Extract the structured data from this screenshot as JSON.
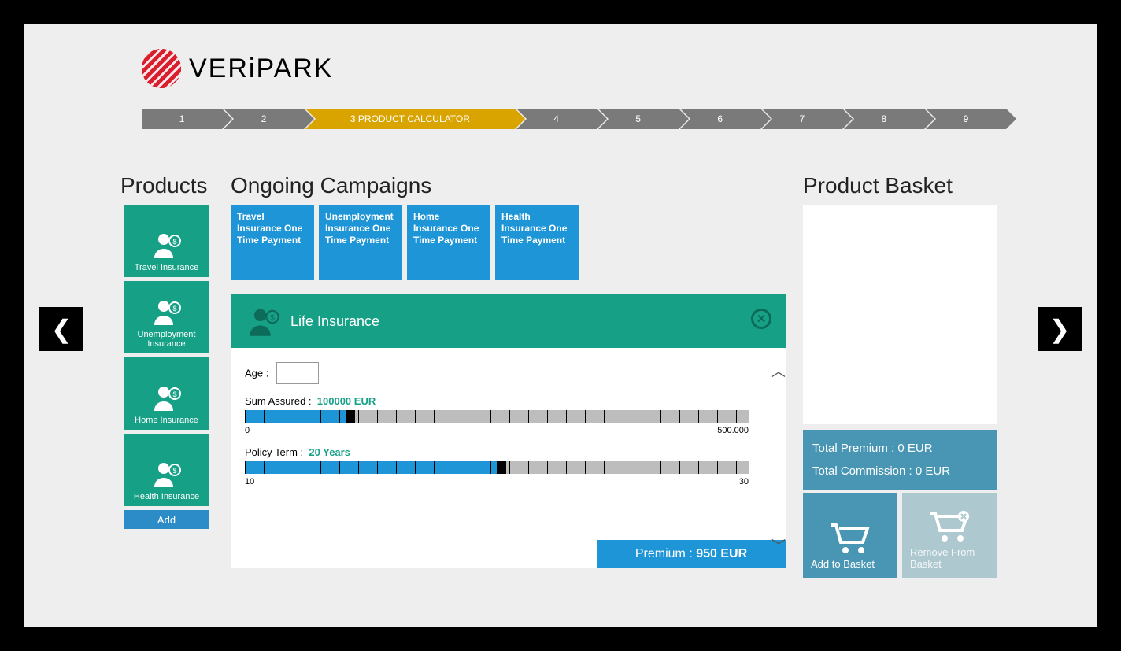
{
  "brand": {
    "name": "VERiPARK"
  },
  "breadcrumb": {
    "steps": [
      "1",
      "2",
      "3 PRODUCT CALCULATOR",
      "4",
      "5",
      "6",
      "7",
      "8",
      "9"
    ],
    "activeIndex": 2
  },
  "sections": {
    "products": "Products",
    "campaigns": "Ongoing Campaigns",
    "basket": "Product Basket"
  },
  "products": [
    {
      "label": "Travel Insurance"
    },
    {
      "label": "Unemployment Insurance"
    },
    {
      "label": "Home Insurance"
    },
    {
      "label": "Health Insurance"
    }
  ],
  "addButton": "Add",
  "campaigns": [
    {
      "label": "Travel Insurance One Time Payment"
    },
    {
      "label": "Unemployment Insurance One Time Payment"
    },
    {
      "label": "Home Insurance One Time Payment"
    },
    {
      "label": "Health Insurance One Time Payment"
    }
  ],
  "calculator": {
    "title": "Life Insurance",
    "ageLabel": "Age :",
    "ageValue": "",
    "sumLabel": "Sum Assured :",
    "sumValue": "100000  EUR",
    "sumMin": "0",
    "sumMax": "500.000",
    "sumPercent": 20,
    "termLabel": "Policy Term :",
    "termValue": "20  Years",
    "termMin": "10",
    "termMax": "30",
    "termPercent": 50,
    "premiumLabel": "Premium :  ",
    "premiumValue": "950  EUR"
  },
  "basket": {
    "totalPremiumLabel": "Total Premium :  ",
    "totalPremiumValue": "0  EUR",
    "totalCommissionLabel": "Total Commission :  ",
    "totalCommissionValue": "0  EUR",
    "addLabel": "Add to Basket",
    "removeLabel": "Remove From Basket"
  }
}
